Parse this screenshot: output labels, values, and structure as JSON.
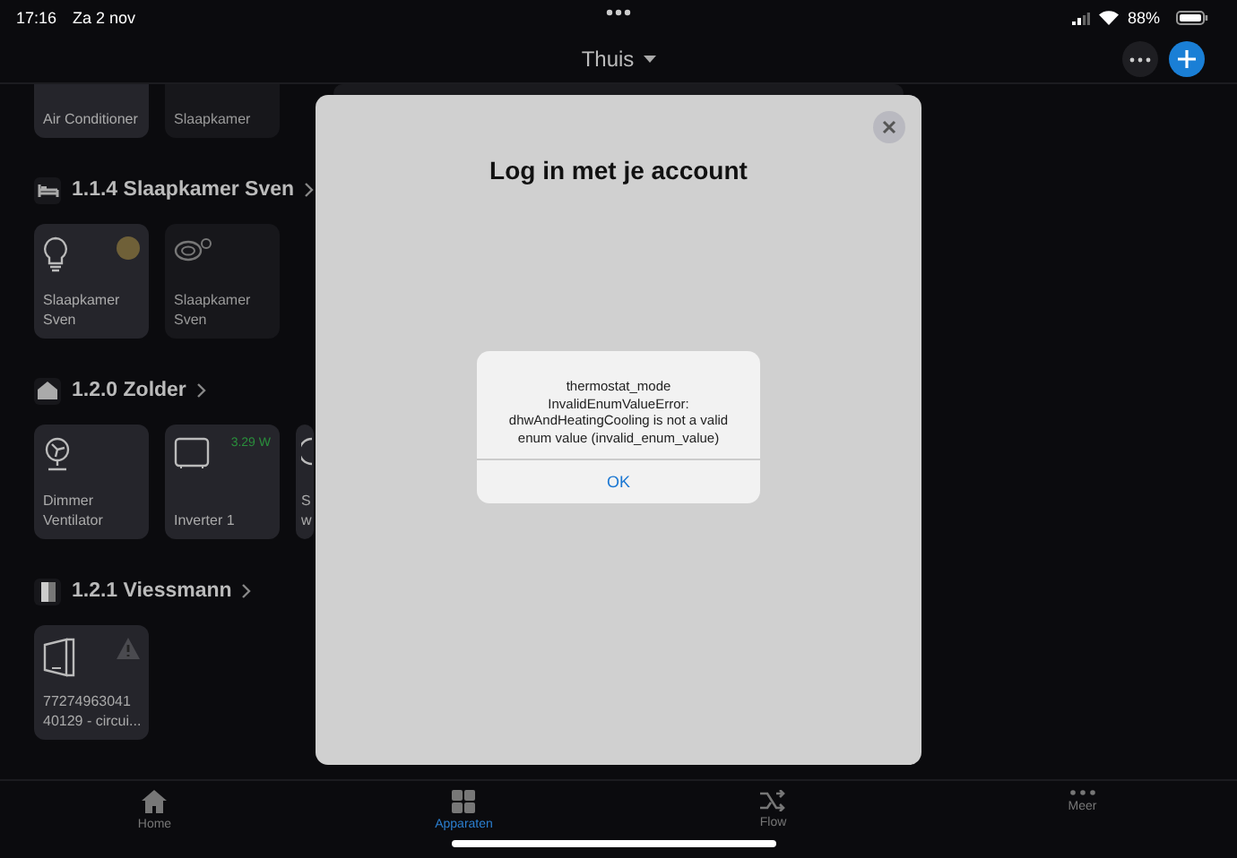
{
  "status_bar": {
    "time": "17:16",
    "date": "Za 2 nov",
    "battery": "88%"
  },
  "header": {
    "title": "Thuis"
  },
  "top_tiles": [
    {
      "label": [
        "Air Conditioner"
      ],
      "on": true
    },
    {
      "label": [
        "Slaapkamer"
      ],
      "on": false
    }
  ],
  "zones": [
    {
      "kind": "bed",
      "title": "1.1.4 Slaapkamer Sven",
      "tiles": [
        {
          "kind": "light",
          "label": [
            "Slaapkamer",
            "Sven"
          ],
          "on": true,
          "indicator": true
        },
        {
          "kind": "appliance",
          "label": [
            "Slaapkamer",
            "Sven"
          ],
          "on": false
        }
      ]
    },
    {
      "kind": "house",
      "title": "1.2.0 Zolder",
      "tiles": [
        {
          "kind": "fan",
          "label": [
            "Dimmer",
            "Ventilator"
          ],
          "on": true
        },
        {
          "kind": "inverter",
          "label": [
            "Inverter 1"
          ],
          "on": true,
          "power": "3.29 W"
        },
        {
          "kind": "partial",
          "label": [
            "S",
            "w"
          ],
          "on": true
        }
      ]
    },
    {
      "kind": "door",
      "title": "1.2.1 Viessmann",
      "tiles": [
        {
          "kind": "boiler",
          "label": [
            "77274963041",
            "40129 - circui..."
          ],
          "on": true,
          "warning": true
        }
      ]
    }
  ],
  "modal": {
    "title": "Log in met je account",
    "alert": {
      "message": "thermostat_mode InvalidEnumValueError: dhwAndHeatingCooling is not a valid enum value (invalid_enum_value)",
      "button": "OK"
    }
  },
  "tab_bar": [
    {
      "kind": "home",
      "label": "Home",
      "selected": false
    },
    {
      "kind": "grid",
      "label": "Apparaten",
      "selected": true
    },
    {
      "kind": "flow",
      "label": "Flow",
      "selected": false
    },
    {
      "kind": "more",
      "label": "Meer",
      "selected": false
    }
  ]
}
